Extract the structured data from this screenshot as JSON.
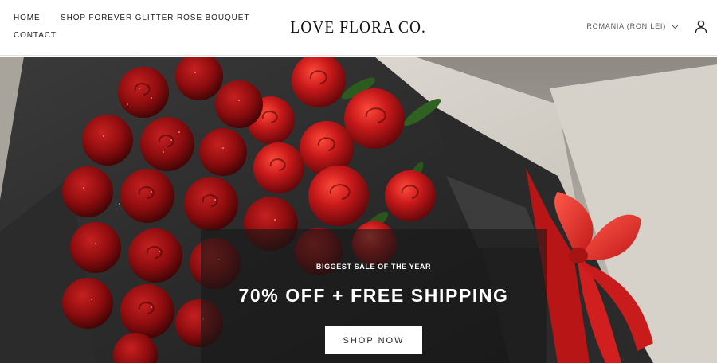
{
  "header": {
    "nav": {
      "home": "HOME",
      "shop": "SHOP FOREVER GLITTER ROSE BOUQUET",
      "contact": "CONTACT"
    },
    "logo": "LOVE FLORA CO.",
    "country_selector": "ROMANIA (RON LEI)",
    "icons": {
      "country_chevron": "chevron-down-icon",
      "account": "user-icon"
    }
  },
  "hero": {
    "image": "bouquet-of-red-glitter-roses-in-gift-box-with-red-ribbon",
    "eyebrow": "BIGGEST SALE OF THE YEAR",
    "headline": "70% OFF + FREE SHIPPING",
    "cta_label": "SHOP NOW"
  },
  "colors": {
    "rose_red": "#c21a1a",
    "wrap_dark": "#2c2c2c",
    "box_grey": "#cfcac2",
    "overlay": "#191919"
  }
}
